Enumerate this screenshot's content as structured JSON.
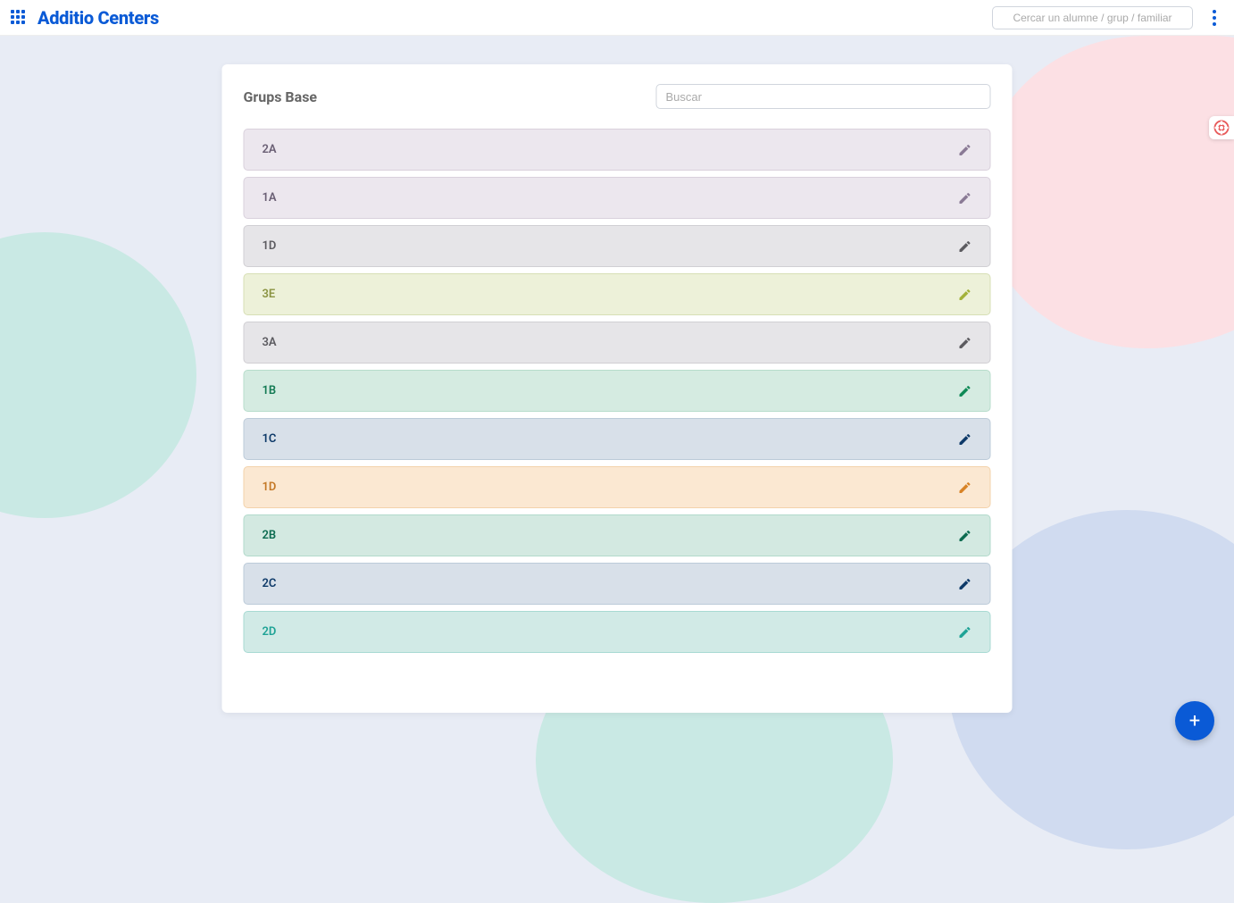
{
  "header": {
    "brand": "Additio Centers",
    "search_placeholder": "Cercar un alumne / grup / familiar"
  },
  "page": {
    "title": "Grups Base",
    "search_placeholder": "Buscar"
  },
  "groups": [
    {
      "label": "2A",
      "bg": "#ece7ee",
      "border": "#d9d0dc",
      "text": "#6a5f74",
      "icon": "#8a7a95"
    },
    {
      "label": "1A",
      "bg": "#ece7ee",
      "border": "#d9d0dc",
      "text": "#6a5f74",
      "icon": "#8a7a95"
    },
    {
      "label": "1D",
      "bg": "#e6e5e8",
      "border": "#d0cfd3",
      "text": "#5c5b60",
      "icon": "#5c5b60"
    },
    {
      "label": "3E",
      "bg": "#edf1d9",
      "border": "#d7dfb5",
      "text": "#8a9341",
      "icon": "#a3b23a"
    },
    {
      "label": "3A",
      "bg": "#e6e5e8",
      "border": "#d0cfd3",
      "text": "#5c5b60",
      "icon": "#5c5b60"
    },
    {
      "label": "1B",
      "bg": "#d5ebe1",
      "border": "#b7dccb",
      "text": "#147a54",
      "icon": "#0f8a56"
    },
    {
      "label": "1C",
      "bg": "#d8e0e9",
      "border": "#bccbd9",
      "text": "#0e3a69",
      "icon": "#0e3a69"
    },
    {
      "label": "1D",
      "bg": "#fbe8d2",
      "border": "#f3d2ab",
      "text": "#c47826",
      "icon": "#d88326"
    },
    {
      "label": "2B",
      "bg": "#d3e9e1",
      "border": "#b2dacb",
      "text": "#0c6b50",
      "icon": "#0c6b50"
    },
    {
      "label": "2C",
      "bg": "#d8e0e9",
      "border": "#bccbd9",
      "text": "#0e3a69",
      "icon": "#0e3a69"
    },
    {
      "label": "2D",
      "bg": "#d1eae6",
      "border": "#a8dad3",
      "text": "#1fa396",
      "icon": "#1fa396"
    }
  ],
  "fab": {
    "plus": "+"
  }
}
